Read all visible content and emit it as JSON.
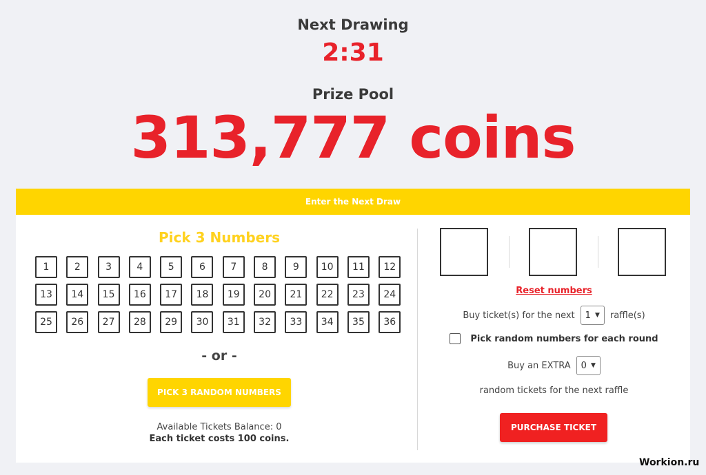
{
  "header": {
    "next_drawing_label": "Next Drawing",
    "countdown": "2:31",
    "prize_pool_label": "Prize Pool",
    "prize_pool_value": "313,777 coins"
  },
  "panel": {
    "title": "Enter the Next Draw",
    "pick_title": "Pick 3 Numbers",
    "numbers": [
      "1",
      "2",
      "3",
      "4",
      "5",
      "6",
      "7",
      "8",
      "9",
      "10",
      "11",
      "12",
      "13",
      "14",
      "15",
      "16",
      "17",
      "18",
      "19",
      "20",
      "21",
      "22",
      "23",
      "24",
      "25",
      "26",
      "27",
      "28",
      "29",
      "30",
      "31",
      "32",
      "33",
      "34",
      "35",
      "36"
    ],
    "or_text": "- or -",
    "random_button": "PICK 3 RANDOM NUMBERS",
    "balance_text": "Available Tickets Balance: 0",
    "cost_text": "Each ticket costs 100 coins."
  },
  "ticket": {
    "reset_link": "Reset numbers",
    "buy_prefix": "Buy ticket(s) for the next",
    "buy_select_value": "1",
    "buy_suffix": "raffle(s)",
    "random_each_round_label": "Pick random numbers for each round",
    "extra_prefix": "Buy an EXTRA",
    "extra_select_value": "0",
    "extra_suffix": "random tickets for the next raffle",
    "purchase_button": "PURCHASE TICKET"
  },
  "watermark": "Workion.ru",
  "colors": {
    "accent_red": "#e8222a",
    "accent_yellow": "#ffd500",
    "background": "#f0f1f5"
  }
}
